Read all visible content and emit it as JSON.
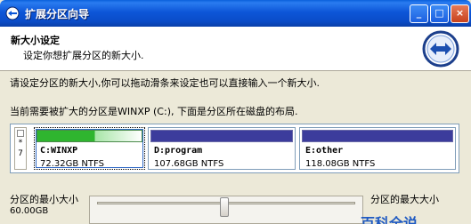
{
  "window": {
    "title": "扩展分区向导",
    "min_symbol": "_",
    "max_symbol": "□",
    "close_symbol": "×"
  },
  "header": {
    "title": "新大小设定",
    "subtitle": "设定你想扩展分区的新大小."
  },
  "instructions": {
    "line1": "请设定分区的新大小,你可以拖动滑条来设定也可以直接输入一个新大小.",
    "line2": "当前需要被扩大的分区是WINXP (C:), 下面是分区所在磁盘的布局."
  },
  "disk": {
    "legend_top": "*",
    "legend_bottom": "7",
    "partitions": [
      {
        "name": "C:WINXP",
        "size": "72.32GB NTFS",
        "used_fraction": 0.55
      },
      {
        "name": "D:program",
        "size": "107.68GB NTFS"
      },
      {
        "name": "E:other",
        "size": "118.08GB NTFS"
      }
    ]
  },
  "resize": {
    "min_label": "分区的最小大小",
    "min_value": "60.00GB",
    "max_label": "分区的最大大小"
  },
  "watermark": "百科全说",
  "colors": {
    "title_bar": "#0a56d8",
    "used_space": "#2fb52f",
    "partition_bar": "#3c3c9c"
  }
}
